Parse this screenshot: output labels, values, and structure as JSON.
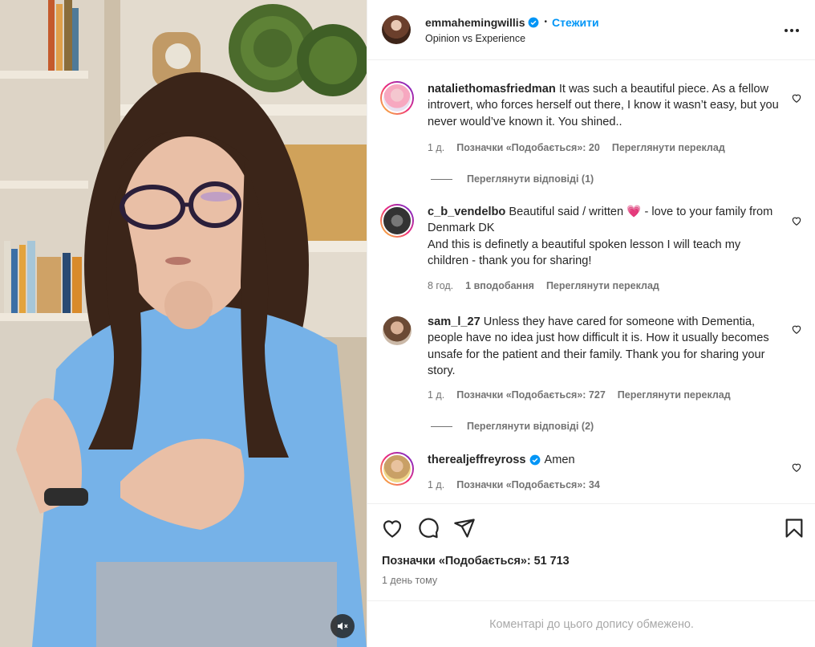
{
  "post": {
    "username": "emmahemingwillis",
    "follow_label": "Стежити",
    "dot": "•",
    "subtitle": "Opinion vs Experience"
  },
  "comments": [
    {
      "username": "nataliethomasfriedman",
      "text": "It was such a beautiful piece. As a fellow introvert, who forces herself out there, I know it wasn’t easy, but you never would’ve known it. You shined..",
      "time": "1 д.",
      "likes": "Позначки «Подобається»: 20",
      "translate": "Переглянути переклад",
      "replies": "Переглянути відповіді (1)"
    },
    {
      "username": "c_b_vendelbo",
      "text_part1": "Beautiful said / written",
      "emoji": "💗",
      "text_part2": "- love to your family from Denmark DK",
      "text_line2": "And this is definetly a beautiful spoken lesson I will teach my children - thank you for sharing!",
      "time": "8 год.",
      "likes": "1 вподобання",
      "translate": "Переглянути переклад"
    },
    {
      "username": "sam_l_27",
      "text": "Unless they have cared for someone with Dementia, people have no idea just how difficult it is. How it usually becomes unsafe for the patient and their family. Thank you for sharing your story.",
      "time": "1 д.",
      "likes": "Позначки «Подобається»: 727",
      "translate": "Переглянути переклад",
      "replies": "Переглянути відповіді (2)"
    },
    {
      "username": "therealjeffreyross",
      "text": "Amen",
      "time": "1 д.",
      "likes": "Позначки «Подобається»: 34"
    }
  ],
  "actions": {
    "likes_count": "Позначки «Подобається»: 51 713",
    "posted_time": "1 день тому"
  },
  "footer": {
    "comments_limited": "Коментарі до цього допису обмежено."
  },
  "colors": {
    "accent": "#0095f6",
    "text": "#262626",
    "muted": "#737373",
    "border": "#efefef"
  },
  "icons": [
    "verified-badge-icon",
    "more-options-icon",
    "heart-icon",
    "comment-icon",
    "share-icon",
    "bookmark-icon",
    "muted-speaker-icon"
  ]
}
